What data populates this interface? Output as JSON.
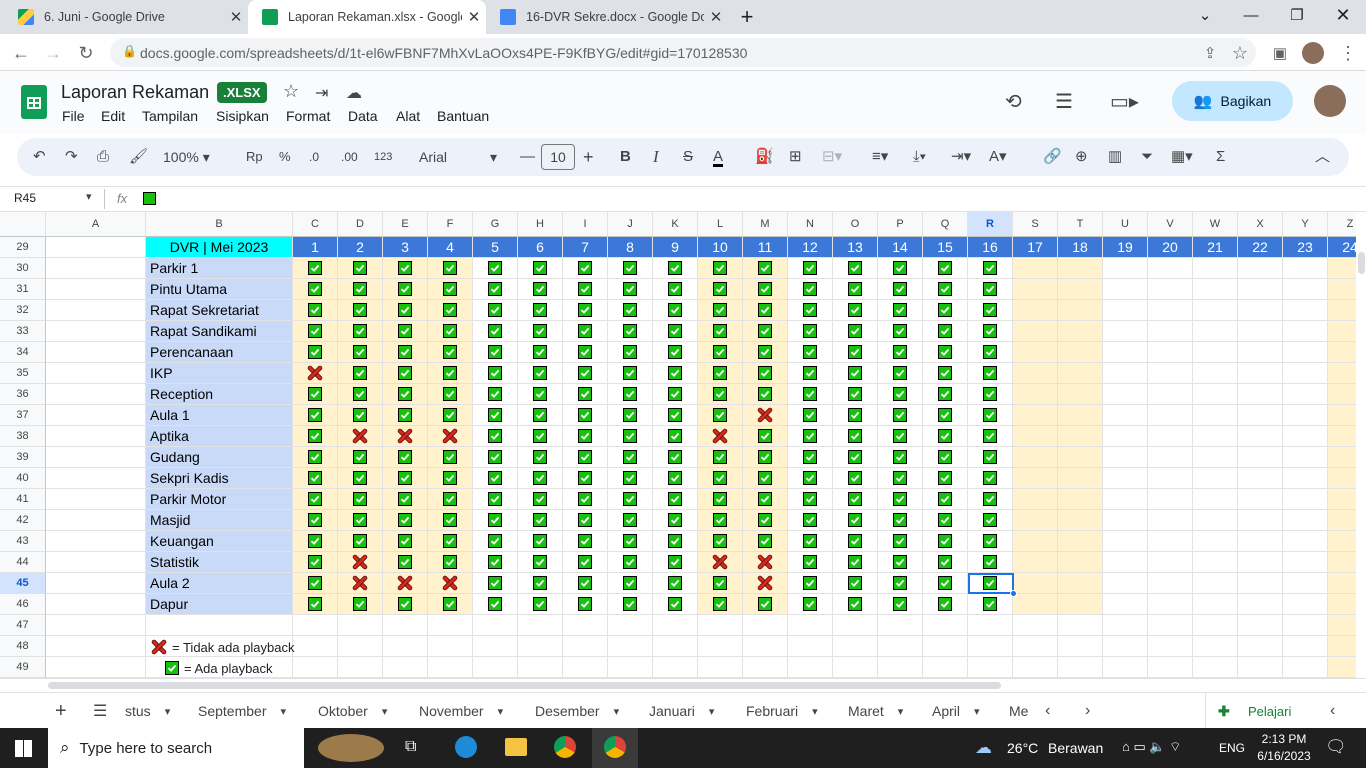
{
  "browser": {
    "tabs": [
      {
        "title": "6. Juni - Google Drive"
      },
      {
        "title": "Laporan Rekaman.xlsx - Google S"
      },
      {
        "title": "16-DVR Sekre.docx - Google Dok"
      }
    ],
    "url": "docs.google.com/spreadsheets/d/1t-el6wFBNF7MhXvLaOOxs4PE-F9KfBYG/edit#gid=170128530"
  },
  "doc": {
    "title": "Laporan Rekaman",
    "badge": ".XLSX",
    "menus": [
      "File",
      "Edit",
      "Tampilan",
      "Sisipkan",
      "Format",
      "Data",
      "Alat",
      "Bantuan"
    ],
    "share": "Bagikan"
  },
  "toolbar": {
    "zoom": "100%",
    "currency": "Rp",
    "percent": "%",
    "dec_less": ".0",
    "dec_more": ".00",
    "numfmt": "123",
    "font": "Arial",
    "size": "10"
  },
  "formula": {
    "cell_ref": "R45",
    "fx": "fx"
  },
  "columns": [
    "A",
    "B",
    "C",
    "D",
    "E",
    "F",
    "G",
    "H",
    "I",
    "J",
    "K",
    "L",
    "M",
    "N",
    "O",
    "P",
    "Q",
    "R",
    "S",
    "T",
    "U",
    "V",
    "W",
    "X",
    "Y",
    "Z"
  ],
  "rows": [
    "29",
    "30",
    "31",
    "32",
    "33",
    "34",
    "35",
    "36",
    "37",
    "38",
    "39",
    "40",
    "41",
    "42",
    "43",
    "44",
    "45",
    "46",
    "47",
    "48",
    "49"
  ],
  "table": {
    "header": "DVR | Mei 2023",
    "days": [
      "1",
      "2",
      "3",
      "4",
      "5",
      "6",
      "7",
      "8",
      "9",
      "10",
      "11",
      "12",
      "13",
      "14",
      "15",
      "16",
      "17",
      "18",
      "19",
      "20",
      "21",
      "22",
      "23",
      "24"
    ],
    "records": [
      {
        "name": "Parkir 1",
        "status": "1111111111111111"
      },
      {
        "name": "Pintu Utama",
        "status": "1111111111111111"
      },
      {
        "name": "Rapat Sekretariat",
        "status": "1111111111111111"
      },
      {
        "name": "Rapat Sandikami",
        "status": "1111111111111111"
      },
      {
        "name": "Perencanaan",
        "status": "1111111111111111"
      },
      {
        "name": "IKP",
        "status": "0111111111111111"
      },
      {
        "name": "Reception",
        "status": "1111111111111111"
      },
      {
        "name": "Aula 1",
        "status": "1111111111011111"
      },
      {
        "name": "Aptika",
        "status": "1000111110111111"
      },
      {
        "name": "Gudang",
        "status": "1111111111111111"
      },
      {
        "name": "Sekpri Kadis",
        "status": "1111111111111111"
      },
      {
        "name": "Parkir Motor",
        "status": "1111111111111111"
      },
      {
        "name": "Masjid",
        "status": "1111111111111111"
      },
      {
        "name": "Keuangan",
        "status": "1111111111111111"
      },
      {
        "name": "Statistik",
        "status": "1011111110011111"
      },
      {
        "name": "Aula 2",
        "status": "1000111111011111"
      },
      {
        "name": "Dapur",
        "status": "1111111111111111"
      }
    ]
  },
  "legend": {
    "cross": "= Tidak ada playback",
    "check": "= Ada playback"
  },
  "sheet_tabs": [
    "stus",
    "September",
    "Oktober",
    "November",
    "Desember",
    "Januari",
    "Februari",
    "Maret",
    "April",
    "Me"
  ],
  "explore": "Pelajari",
  "taskbar": {
    "search": "Type here to search",
    "temp": "26°C",
    "weather": "Berawan",
    "lang": "ENG",
    "time": "2:13 PM",
    "date": "6/16/2023"
  }
}
